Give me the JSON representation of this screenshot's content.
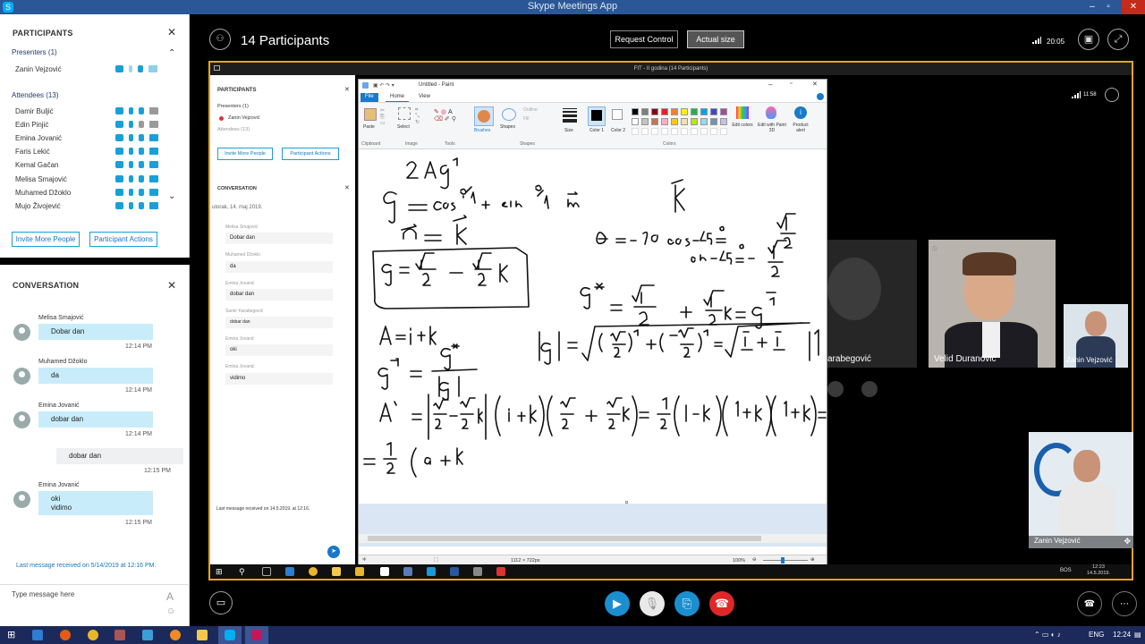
{
  "window": {
    "title": "Skype Meetings App",
    "controls": [
      "–",
      "▫",
      "✕"
    ]
  },
  "left_panel": {
    "participants_title": "PARTICIPANTS",
    "presenters_label": "Presenters (1)",
    "presenters": [
      "Zanin Vejzović"
    ],
    "attendees_label": "Attendees (13)",
    "attendees": [
      "Damir Buljić",
      "Edin Pinjić",
      "Emina Jovanić",
      "Faris Lekić",
      "Kemal Gačan",
      "Melisa Smajović",
      "Muhamed Džoklo",
      "Mujo Živojević"
    ],
    "invite_button": "Invite More People",
    "actions_button": "Participant Actions",
    "conversation_title": "CONVERSATION",
    "messages": [
      {
        "name": "Melisa Smajović",
        "text": "Dobar dan",
        "time": "12:14 PM"
      },
      {
        "name": "Muhamed Džoklo",
        "text": "da",
        "time": "12:14 PM"
      },
      {
        "name": "Emina Jovanić",
        "text": "dobar dan",
        "time": "12:14 PM"
      },
      {
        "name": "",
        "text": "dobar dan",
        "time": "12:15 PM"
      },
      {
        "name": "Emina Jovanić",
        "text": "oki",
        "text2": "vidimo",
        "time": "12:15 PM"
      }
    ],
    "last_message": "Last message received on 5/14/2019 at 12:16 PM.",
    "compose_placeholder": "Type message here",
    "font_icon": "A"
  },
  "topbar": {
    "participants_count": "14 Participants",
    "request_control": "Request Control",
    "actual_size": "Actual size",
    "time": "20:05"
  },
  "shared_screen": {
    "title": "FIT - II godina (14 Participants)",
    "inner_left": {
      "participants_title": "PARTICIPANTS",
      "presenters_label": "Presenters (1)",
      "presenter": "Zanin Vejzović",
      "attendees_label": "Attendees (13)",
      "invite_button": "Invite More People",
      "actions_button": "Participant Actions",
      "conversation_title": "CONVERSATION",
      "date": "utorak, 14. maj 2019.",
      "messages": [
        {
          "name": "Melisa Smajović",
          "text": "Dobar dan"
        },
        {
          "name": "Muhamed Džoklo",
          "text": "da"
        },
        {
          "name": "Emina Jovanić",
          "text": "dobar dan"
        },
        {
          "name": "Samir Karabegović",
          "text": "dobar dan"
        },
        {
          "name": "Emina Jovanić",
          "text": "oki"
        },
        {
          "name": "Emina Jovanić",
          "text": "vidimo"
        }
      ],
      "last_message": "Last message received on 14.5.2019. at 12:16."
    },
    "paint": {
      "title": "Untitled - Paint",
      "tabs": [
        "File",
        "Home",
        "View"
      ],
      "groups": [
        "Clipboard",
        "Image",
        "Tools",
        "Shapes",
        "Colors"
      ],
      "tools": {
        "paste": "Paste",
        "select": "Select",
        "brushes": "Brushes",
        "shapes": "Shapes",
        "outline": "Outline",
        "fill": "Fill",
        "size": "Size",
        "color1": "Color 1",
        "color2": "Color 2",
        "edit_colors": "Edit colors",
        "edit_with_3d": "Edit with Paint 3D",
        "product_alert": "Product alert"
      },
      "status_size": "1112 × 722px",
      "zoom": "100%",
      "palette": [
        "#000000",
        "#7f7f7f",
        "#880015",
        "#ed1c24",
        "#ff7f27",
        "#fff200",
        "#22b14c",
        "#00a2e8",
        "#3f48cc",
        "#a349a4",
        "#ffffff",
        "#c3c3c3",
        "#b97a57",
        "#ffaec9",
        "#ffc90e",
        "#efe4b0",
        "#b5e61d",
        "#99d9ea",
        "#7092be",
        "#c8bfe7"
      ]
    },
    "inner_time": "11:58",
    "tiles": [
      {
        "name": "Karabegović",
        "label_visible": "arabegović"
      },
      {
        "name": "Velid Duranović"
      },
      {
        "name": "Zanin Vejzović"
      }
    ],
    "self_view_name": "Zanin Vejzović",
    "inner_tray": {
      "lang": "BOS",
      "time": "12:23",
      "date": "14.5.2019."
    }
  },
  "taskbar": {
    "lang": "ENG",
    "time": "12:24"
  },
  "colors": {
    "accent": "#19a0d8",
    "presenting_border": "#e7a41e",
    "hangup": "#e02727",
    "title_bar": "#2b5797"
  }
}
